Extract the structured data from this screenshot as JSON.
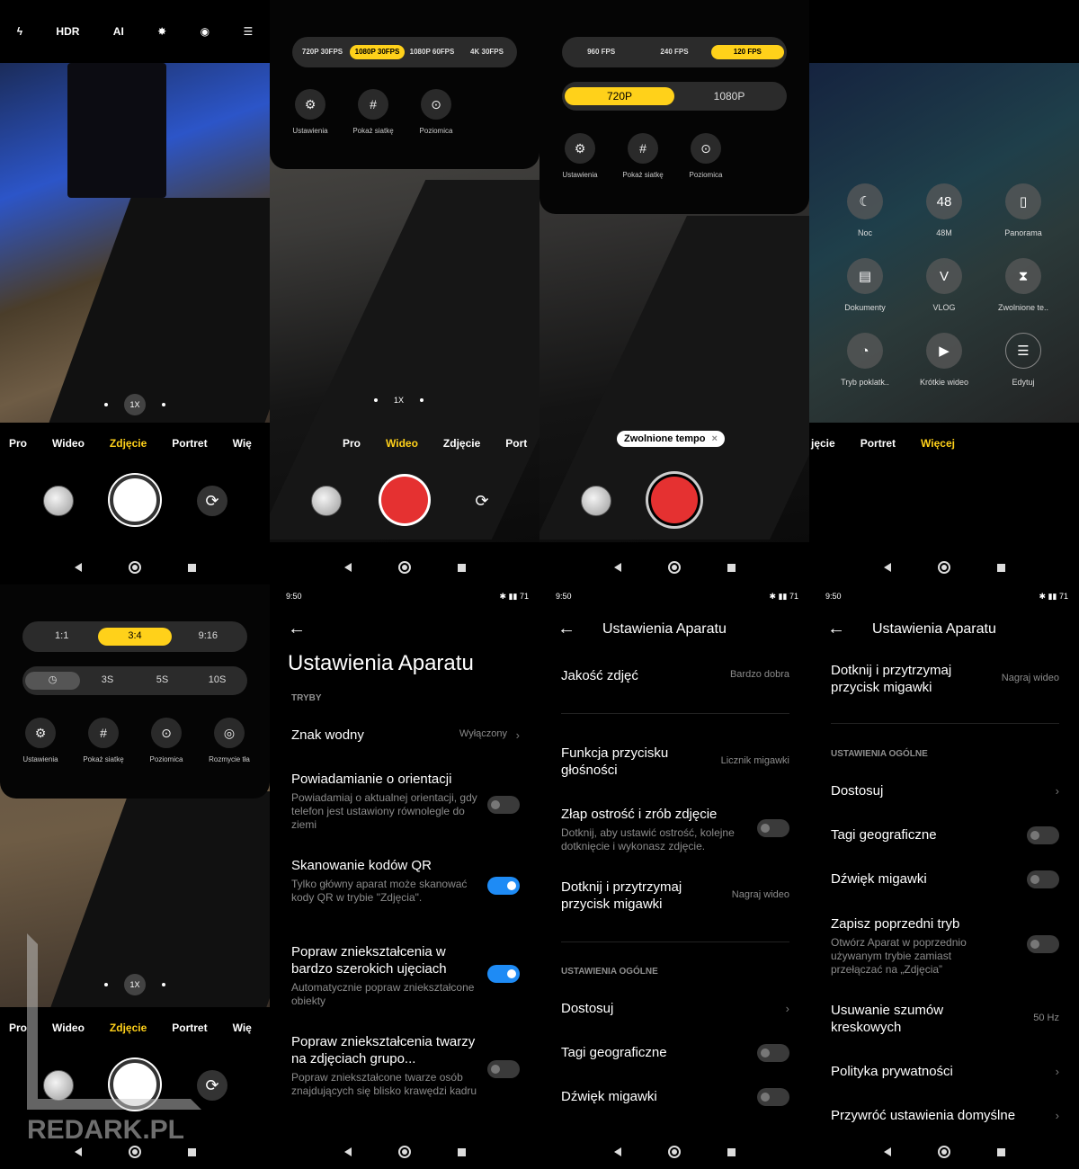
{
  "s1": {
    "top_icons": [
      "flash-off-icon",
      "hdr-icon",
      "ai-icon",
      "beauty-icon",
      "lens-icon",
      "menu-icon"
    ],
    "top_labels": [
      "",
      "HDR",
      "AI",
      "",
      "",
      ""
    ],
    "zoom": "1X",
    "modes": [
      "Pro",
      "Wideo",
      "Zdjęcie",
      "Portret",
      "Wię"
    ]
  },
  "s2": {
    "res": [
      "720P 30FPS",
      "1080P 30FPS",
      "1080P 60FPS",
      "4K 30FPS"
    ],
    "tools": [
      "Ustawienia",
      "Pokaż siatkę",
      "Poziomica"
    ],
    "zoom": "1X",
    "modes": [
      "Pro",
      "Wideo",
      "Zdjęcie",
      "Port"
    ]
  },
  "s3": {
    "fps": [
      "960 FPS",
      "240 FPS",
      "120 FPS"
    ],
    "res": [
      "720P",
      "1080P"
    ],
    "tools": [
      "Ustawienia",
      "Pokaż siatkę",
      "Poziomica"
    ],
    "tag": "Zwolnione tempo"
  },
  "s4": {
    "items": [
      "Noc",
      "48M",
      "Panorama",
      "Dokumenty",
      "VLOG",
      "Zwolnione te..",
      "Tryb poklatk..",
      "Krótkie wideo",
      "Edytuj"
    ],
    "badge48": "48",
    "modes": [
      "jęcie",
      "Portret",
      "Więcej"
    ]
  },
  "s5": {
    "ratio": [
      "1:1",
      "3:4",
      "9:16"
    ],
    "timer": [
      "3S",
      "5S",
      "10S"
    ],
    "tools": [
      "Ustawienia",
      "Pokaż siatkę",
      "Poziomica",
      "Rozmycie tła"
    ],
    "zoom": "1X",
    "modes": [
      "Pro",
      "Wideo",
      "Zdjęcie",
      "Portret",
      "Wię"
    ],
    "watermark": "REDARK.PL"
  },
  "s6": {
    "time": "9:50",
    "battery": "71",
    "title": "Ustawienia Aparatu",
    "section": "TRYBY",
    "watermark": {
      "t": "Znak wodny",
      "v": "Wyłączony"
    },
    "orient": {
      "t": "Powiadamianie o orientacji",
      "d": "Powiadamiaj o aktualnej orientacji, gdy telefon jest ustawiony równolegle do ziemi"
    },
    "qr": {
      "t": "Skanowanie kodów QR",
      "d": "Tylko główny aparat może skanować kody QR w trybie \"Zdjęcia\"."
    },
    "wide": {
      "t": "Popraw zniekształcenia w bardzo szerokich ujęciach",
      "d": "Automatycznie popraw zniekształcone obiekty"
    },
    "face": {
      "t": "Popraw zniekształcenia twarzy na zdjęciach grupo...",
      "d": "Popraw zniekształcone twarze osób znajdujących się blisko krawędzi kadru"
    }
  },
  "s7": {
    "time": "9:50",
    "battery": "71",
    "title": "Ustawienia Aparatu",
    "quality": {
      "t": "Jakość zdjęć",
      "v": "Bardzo dobra"
    },
    "volume": {
      "t": "Funkcja przycisku głośności",
      "v": "Licznik migawki"
    },
    "focus": {
      "t": "Złap ostrość i zrób zdjęcie",
      "d": "Dotknij, aby ustawić ostrość, kolejne dotknięcie i wykonasz zdjęcie."
    },
    "hold": {
      "t": "Dotknij i przytrzymaj przycisk migawki",
      "v": "Nagraj wideo"
    },
    "section": "USTAWIENIA OGÓLNE",
    "customize": "Dostosuj",
    "geo": "Tagi geograficzne",
    "sound": "Dźwięk migawki"
  },
  "s8": {
    "time": "9:50",
    "battery": "71",
    "title": "Ustawienia Aparatu",
    "hold": {
      "t": "Dotknij i przytrzymaj przycisk migawki",
      "v": "Nagraj wideo"
    },
    "section": "USTAWIENIA OGÓLNE",
    "customize": "Dostosuj",
    "geo": "Tagi geograficzne",
    "sound": "Dźwięk migawki",
    "prev": {
      "t": "Zapisz poprzedni tryb",
      "d": "Otwórz Aparat w poprzednio używanym trybie zamiast przełączać na „Zdjęcia”"
    },
    "flicker": {
      "t": "Usuwanie szumów kreskowych",
      "v": "50 Hz"
    },
    "privacy": "Polityka prywatności",
    "reset": "Przywróć ustawienia domyślne"
  }
}
